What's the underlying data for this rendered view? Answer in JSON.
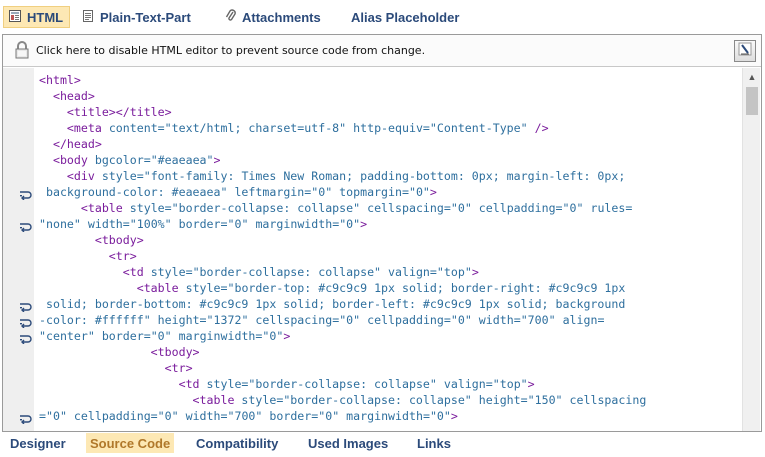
{
  "top_tabs": [
    {
      "label": "HTML",
      "icon": "html-doc-icon",
      "active": true
    },
    {
      "label": "Plain-Text-Part",
      "icon": "text-doc-icon",
      "active": false
    },
    {
      "label": "Attachments",
      "icon": "paperclip-icon",
      "active": false
    },
    {
      "label": "Alias Placeholder",
      "icon": "",
      "active": false
    }
  ],
  "notice": {
    "text": "Click here to disable HTML editor to prevent source code from change.",
    "icon": "lock-icon"
  },
  "edit_button_icon": "pen-edit-icon",
  "code_lines": [
    {
      "wrapped": false,
      "segments": [
        [
          "t",
          "<html>"
        ]
      ]
    },
    {
      "wrapped": false,
      "segments": [
        [
          "t",
          "  <head>"
        ]
      ]
    },
    {
      "wrapped": false,
      "segments": [
        [
          "t",
          "    <title>"
        ],
        [
          "t",
          "</title>"
        ]
      ]
    },
    {
      "wrapped": false,
      "segments": [
        [
          "t",
          "    <meta "
        ],
        [
          "a",
          "content="
        ],
        [
          "v",
          "\"text/html; charset=utf-8\" "
        ],
        [
          "a",
          "http-equiv="
        ],
        [
          "v",
          "\"Content-Type\" "
        ],
        [
          "t",
          "/>"
        ]
      ]
    },
    {
      "wrapped": false,
      "segments": [
        [
          "t",
          "  </head>"
        ]
      ]
    },
    {
      "wrapped": false,
      "segments": [
        [
          "t",
          "  <body "
        ],
        [
          "a",
          "bgcolor="
        ],
        [
          "v",
          "\"#eaeaea\""
        ],
        [
          "t",
          ">"
        ]
      ]
    },
    {
      "wrapped": false,
      "segments": [
        [
          "t",
          "    <div "
        ],
        [
          "a",
          "style="
        ],
        [
          "v",
          "\"font-family: Times New Roman; padding-bottom: 0px; margin-left: 0px;"
        ]
      ]
    },
    {
      "wrapped": true,
      "segments": [
        [
          "v",
          " background-color: #eaeaea\" "
        ],
        [
          "a",
          "leftmargin="
        ],
        [
          "v",
          "\"0\" "
        ],
        [
          "a",
          "topmargin="
        ],
        [
          "v",
          "\"0\""
        ],
        [
          "t",
          ">"
        ]
      ]
    },
    {
      "wrapped": false,
      "segments": [
        [
          "t",
          "      <table "
        ],
        [
          "a",
          "style="
        ],
        [
          "v",
          "\"border-collapse: collapse\" "
        ],
        [
          "a",
          "cellspacing="
        ],
        [
          "v",
          "\"0\" "
        ],
        [
          "a",
          "cellpadding="
        ],
        [
          "v",
          "\"0\" "
        ],
        [
          "a",
          "rules="
        ]
      ]
    },
    {
      "wrapped": true,
      "segments": [
        [
          "v",
          "\"none\" "
        ],
        [
          "a",
          "width="
        ],
        [
          "v",
          "\"100%\" "
        ],
        [
          "a",
          "border="
        ],
        [
          "v",
          "\"0\" "
        ],
        [
          "a",
          "marginwidth="
        ],
        [
          "v",
          "\"0\""
        ],
        [
          "t",
          ">"
        ]
      ]
    },
    {
      "wrapped": false,
      "segments": [
        [
          "t",
          "        <tbody>"
        ]
      ]
    },
    {
      "wrapped": false,
      "segments": [
        [
          "t",
          "          <tr>"
        ]
      ]
    },
    {
      "wrapped": false,
      "segments": [
        [
          "t",
          "            <td "
        ],
        [
          "a",
          "style="
        ],
        [
          "v",
          "\"border-collapse: collapse\" "
        ],
        [
          "a",
          "valign="
        ],
        [
          "v",
          "\"top\""
        ],
        [
          "t",
          ">"
        ]
      ]
    },
    {
      "wrapped": false,
      "segments": [
        [
          "t",
          "              <table "
        ],
        [
          "a",
          "style="
        ],
        [
          "v",
          "\"border-top: #c9c9c9 1px solid; border-right: #c9c9c9 1px"
        ]
      ]
    },
    {
      "wrapped": true,
      "segments": [
        [
          "v",
          " solid; border-bottom: #c9c9c9 1px solid; border-left: #c9c9c9 1px solid; background"
        ]
      ]
    },
    {
      "wrapped": true,
      "segments": [
        [
          "v",
          "-color: #ffffff\" "
        ],
        [
          "a",
          "height="
        ],
        [
          "v",
          "\"1372\" "
        ],
        [
          "a",
          "cellspacing="
        ],
        [
          "v",
          "\"0\" "
        ],
        [
          "a",
          "cellpadding="
        ],
        [
          "v",
          "\"0\" "
        ],
        [
          "a",
          "width="
        ],
        [
          "v",
          "\"700\" "
        ],
        [
          "a",
          "align="
        ]
      ]
    },
    {
      "wrapped": true,
      "segments": [
        [
          "v",
          "\"center\" "
        ],
        [
          "a",
          "border="
        ],
        [
          "v",
          "\"0\" "
        ],
        [
          "a",
          "marginwidth="
        ],
        [
          "v",
          "\"0\""
        ],
        [
          "t",
          ">"
        ]
      ]
    },
    {
      "wrapped": false,
      "segments": [
        [
          "t",
          "                <tbody>"
        ]
      ]
    },
    {
      "wrapped": false,
      "segments": [
        [
          "t",
          "                  <tr>"
        ]
      ]
    },
    {
      "wrapped": false,
      "segments": [
        [
          "t",
          "                    <td "
        ],
        [
          "a",
          "style="
        ],
        [
          "v",
          "\"border-collapse: collapse\" "
        ],
        [
          "a",
          "valign="
        ],
        [
          "v",
          "\"top\""
        ],
        [
          "t",
          ">"
        ]
      ]
    },
    {
      "wrapped": false,
      "segments": [
        [
          "t",
          "                      <table "
        ],
        [
          "a",
          "style="
        ],
        [
          "v",
          "\"border-collapse: collapse\" "
        ],
        [
          "a",
          "height="
        ],
        [
          "v",
          "\"150\" "
        ],
        [
          "a",
          "cellspacing"
        ]
      ]
    },
    {
      "wrapped": true,
      "segments": [
        [
          "v",
          "=\"0\" "
        ],
        [
          "a",
          "cellpadding="
        ],
        [
          "v",
          "\"0\" "
        ],
        [
          "a",
          "width="
        ],
        [
          "v",
          "\"700\" "
        ],
        [
          "a",
          "border="
        ],
        [
          "v",
          "\"0\" "
        ],
        [
          "a",
          "marginwidth="
        ],
        [
          "v",
          "\"0\""
        ],
        [
          "t",
          ">"
        ]
      ]
    }
  ],
  "bottom_tabs": [
    {
      "label": "Designer",
      "active": false
    },
    {
      "label": "Source Code",
      "active": true
    },
    {
      "label": "Compatibility",
      "active": false
    },
    {
      "label": "Used Images",
      "active": false
    },
    {
      "label": "Links",
      "active": false
    }
  ]
}
